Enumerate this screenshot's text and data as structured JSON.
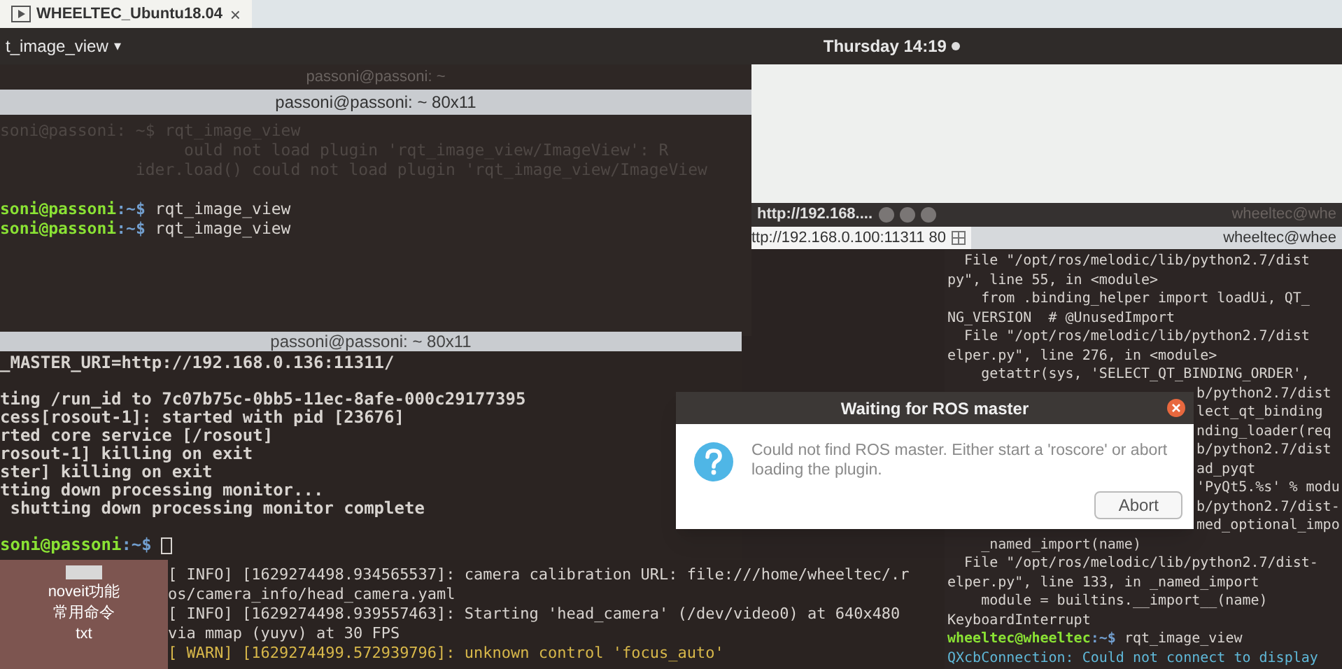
{
  "vm_tab": {
    "title": "WHEELTEC_Ubuntu18.04",
    "close": "×"
  },
  "top_bar": {
    "app_menu": "t_image_view",
    "menu_arrow": "▾",
    "clock": "Thursday 14:19"
  },
  "terminal_top": {
    "back_title": "passoni@passoni: ~",
    "title": "passoni@passoni: ~ 80x11",
    "lines": [
      {
        "kind": "faint",
        "text": "soni@passoni: ~$ rqt_image_view"
      },
      {
        "kind": "faint",
        "text": "                   ould not load plugin 'rqt_image_view/ImageView': R"
      },
      {
        "kind": "faint",
        "text": "              ider.load() could not load plugin 'rqt_image_view/ImageView"
      },
      {
        "kind": "blank"
      },
      {
        "kind": "prompt",
        "user": "soni@passoni",
        "path": ":~$",
        "text": " rqt_image_view"
      },
      {
        "kind": "prompt",
        "user": "soni@passoni",
        "path": ":~$",
        "text": " rqt_image_view"
      }
    ]
  },
  "browser_window": {
    "title": "http://192.168....",
    "url": "ttp://192.168.0.100:11311 80"
  },
  "terminal_right": {
    "back_title": "wheeltec@whe",
    "title": "wheeltec@whee",
    "lines": [
      {
        "kind": "plain",
        "text": "  File \"/opt/ros/melodic/lib/python2.7/dist"
      },
      {
        "kind": "plain",
        "text": "py\", line 55, in <module>"
      },
      {
        "kind": "plain",
        "text": "    from .binding_helper import loadUi, QT_"
      },
      {
        "kind": "plain",
        "text": "NG_VERSION  # @UnusedImport"
      },
      {
        "kind": "plain",
        "text": "  File \"/opt/ros/melodic/lib/python2.7/dist"
      },
      {
        "kind": "plain",
        "text": "elper.py\", line 276, in <module>"
      },
      {
        "kind": "plain",
        "text": "    getattr(sys, 'SELECT_QT_BINDING_ORDER',"
      },
      {
        "kind": "partial",
        "text": "b/python2.7/dist"
      },
      {
        "kind": "partial",
        "text": "lect_qt_binding"
      },
      {
        "kind": "partial",
        "text": "nding_loader(req"
      },
      {
        "kind": "partial",
        "text": "b/python2.7/dist"
      },
      {
        "kind": "partial",
        "text": "ad_pyqt"
      },
      {
        "kind": "partial",
        "text": "'PyQt5.%s' % modu"
      },
      {
        "kind": "partial",
        "text": "b/python2.7/dist-"
      },
      {
        "kind": "partial",
        "text": "med_optional_impo"
      },
      {
        "kind": "plain",
        "text": "    _named_import(name)"
      },
      {
        "kind": "plain",
        "text": "  File \"/opt/ros/melodic/lib/python2.7/dist-"
      },
      {
        "kind": "plain",
        "text": "elper.py\", line 133, in _named_import"
      },
      {
        "kind": "plain",
        "text": "    module = builtins.__import__(name)"
      },
      {
        "kind": "plain",
        "text": "KeyboardInterrupt"
      },
      {
        "kind": "prompt",
        "user": "wheeltec@wheeltec",
        "path": ":~$",
        "text": " rqt_image_view"
      },
      {
        "kind": "error",
        "text": "QXcbConnection: Could not connect to display"
      }
    ]
  },
  "terminal_middle": {
    "title": "passoni@passoni: ~ 80x11",
    "lines": [
      {
        "kind": "plain",
        "text": "_MASTER_URI=http://192.168.0.136:11311/"
      },
      {
        "kind": "blank"
      },
      {
        "kind": "plain",
        "text": "ting /run_id to 7c07b75c-0bb5-11ec-8afe-000c29177395"
      },
      {
        "kind": "plain",
        "text": "cess[rosout-1]: started with pid [23676]"
      },
      {
        "kind": "plain",
        "text": "rted core service [/rosout]"
      },
      {
        "kind": "plain",
        "text": "rosout-1] killing on exit"
      },
      {
        "kind": "plain",
        "text": "ster] killing on exit"
      },
      {
        "kind": "plain",
        "text": "tting down processing monitor..."
      },
      {
        "kind": "plain",
        "text": " shutting down processing monitor complete"
      },
      {
        "kind": "blank"
      },
      {
        "kind": "prompt",
        "user": "soni@passoni",
        "path": ":~$",
        "cursor": true
      }
    ]
  },
  "terminal_bottom": {
    "lines": [
      {
        "kind": "info",
        "text": "[ INFO] [1629274498.934565537]: camera calibration URL: file:///home/wheeltec/.r"
      },
      {
        "kind": "info",
        "text": "os/camera_info/head_camera.yaml"
      },
      {
        "kind": "info",
        "text": "[ INFO] [1629274498.939557463]: Starting 'head_camera' (/dev/video0) at 640x480"
      },
      {
        "kind": "info",
        "text": "via mmap (yuyv) at 30 FPS"
      },
      {
        "kind": "warn",
        "text": "[ WARN] [1629274499.572939796]: unknown control 'focus_auto'"
      }
    ]
  },
  "desktop_icon": {
    "label": [
      "noveit功能",
      "常用命令",
      "txt"
    ]
  },
  "dialog": {
    "title": "Waiting for ROS master",
    "message": "Could not find ROS master. Either start a 'roscore' or abort loading the plugin.",
    "button": "Abort"
  }
}
